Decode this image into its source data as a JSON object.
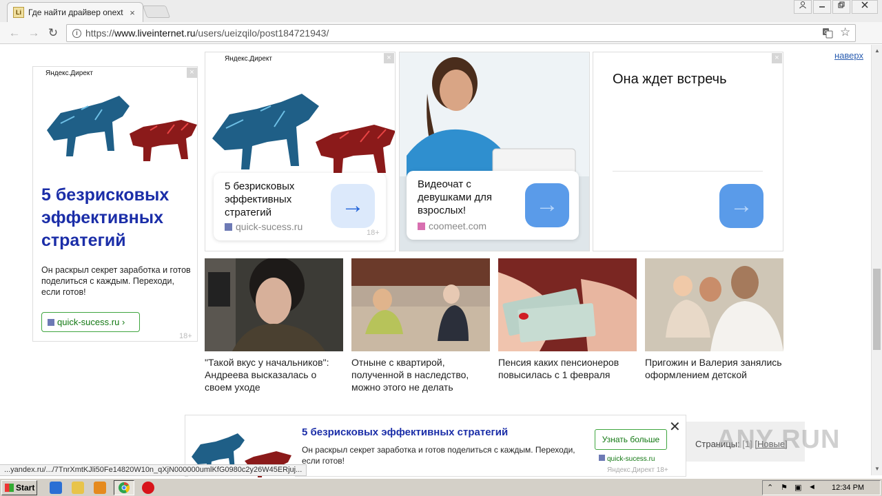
{
  "browser": {
    "tab_title": "Где найти драйвер onext",
    "tab_close": "×",
    "favicon_text": "Li",
    "url_scheme": "https://",
    "url_host": "www.liveinternet.ru",
    "url_path": "/users/ueizqilo/post184721943/",
    "icons": [
      "back-arrow-icon",
      "forward-arrow-icon",
      "reload-icon",
      "info-icon",
      "translate-icon",
      "star-icon",
      "user-icon",
      "minimize-icon",
      "restore-icon",
      "close-icon"
    ]
  },
  "page": {
    "naverh": "наверх",
    "ad_left": {
      "label": "Яндекс.Директ",
      "headline": "5 безрисковых эффективных стратегий",
      "body": "Он раскрыл секрет заработка и готов поделиться с каждым. Переходи, если готов!",
      "domain": "quick-sucess.ru",
      "domain_arrow": "›",
      "age": "18+",
      "close": "×"
    },
    "ad_cards": [
      {
        "label": "Яндекс.Директ",
        "title": "5 безрисковых эффективных стратегий",
        "domain": "quick-sucess.ru",
        "age": "18+",
        "close": "×",
        "arrow": "→"
      },
      {
        "title": "Видеочат с девушками для взрослых!",
        "domain": "coomeet.com",
        "close": "×",
        "arrow": "→"
      },
      {
        "title": "Она ждет встречь",
        "close": "×",
        "arrow": "→"
      }
    ],
    "news": [
      {
        "caption": "\"Такой вкус у начальников\": Андреева высказалась о своем уходе"
      },
      {
        "caption": "Отныне с квартирой, полученной в наследство, можно этого не делать"
      },
      {
        "caption": "Пенсия каких пенсионеров повысилась с 1 февраля"
      },
      {
        "caption": "Пригожин и Валерия занялись оформлением детской"
      }
    ],
    "bottom_banner": {
      "title": "5 безрисковых эффективных стратегий",
      "body": "Он раскрыл секрет заработка и готов поделиться с каждым. Переходи, если готов!",
      "button": "Узнать больше",
      "domain": "quick-sucess.ru",
      "footer": "Яндекс.Директ  18+",
      "close": "✕"
    },
    "pager": {
      "label": "Страницы:",
      "current": "[1]",
      "newer": "[Новые]"
    },
    "watermark": "ANY RUN"
  },
  "status_url": "...yandex.ru/.../7TnrXmtKJli50Fe14820W10n_qXjN000000umlKfG0980c2y26W45ERjuj...",
  "taskbar": {
    "start": "Start",
    "clock": "12:34 PM",
    "colors": {
      "ie": "#2a6fd4",
      "folder": "#e8c44a",
      "media": "#e58a1e",
      "chrome": "#2da44e",
      "opera": "#d8141b"
    }
  }
}
